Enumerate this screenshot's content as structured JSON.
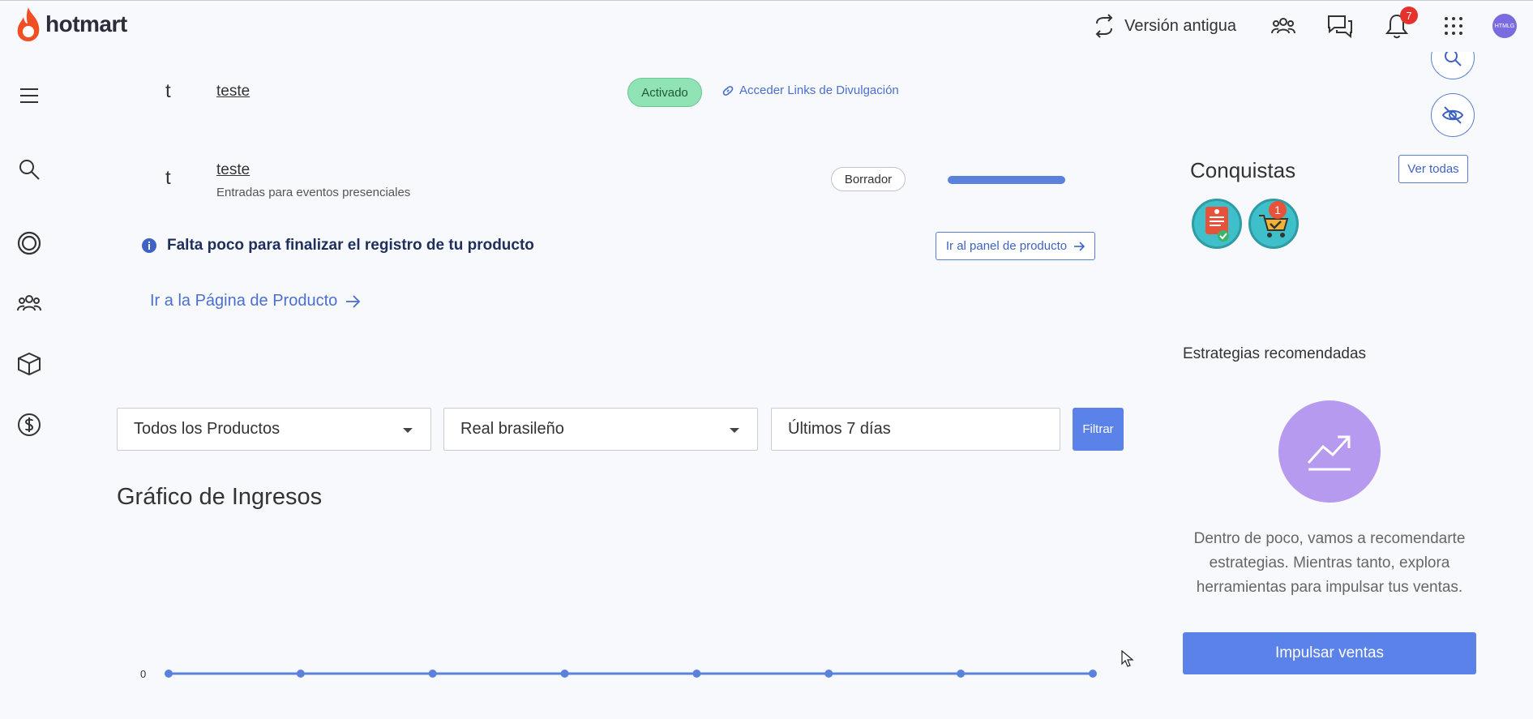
{
  "header": {
    "logo_text": "hotmart",
    "old_version_label": "Versión antigua",
    "notifications_count": "7",
    "avatar_text": "HTMLG"
  },
  "sidebar": {
    "items": [
      "menu-icon",
      "search-icon",
      "target-icon",
      "users-icon",
      "box-icon",
      "dollar-icon"
    ]
  },
  "products": [
    {
      "initial": "t",
      "name": "teste",
      "status": "Activado",
      "link_label": "Acceder Links de Divulgación"
    },
    {
      "initial": "t",
      "name": "teste",
      "subtitle": "Entradas para eventos presenciales",
      "status": "Borrador",
      "progress": 1.0
    }
  ],
  "notice": {
    "text": "Falta poco para finalizar el registro de tu producto",
    "button_label": "Ir al panel de producto"
  },
  "product_page_link": "Ir a la Página de Producto",
  "filters": {
    "products": "Todos los Productos",
    "currency": "Real brasileño",
    "period": "Últimos 7 días",
    "button": "Filtrar"
  },
  "chart_title": "Gráfico de Ingresos",
  "chart_data": {
    "type": "line",
    "x": [
      1,
      2,
      3,
      4,
      5,
      6,
      7,
      8
    ],
    "values": [
      0,
      0,
      0,
      0,
      0,
      0,
      0,
      0
    ],
    "y_tick_label": "0",
    "color": "#5a82dc"
  },
  "achievements": {
    "title": "Conquistas",
    "view_all": "Ver todas",
    "badge_count_label": "1"
  },
  "strategies": {
    "title": "Estrategias recomendadas",
    "text": "Dentro de poco, vamos a recomendarte estrategias. Mientras tanto, explora herramientas para impulsar tus ventas.",
    "button": "Impulsar ventas"
  },
  "colors": {
    "accent": "#5a82e8",
    "active_pill": "#8fe3b4",
    "notification": "#e5322d",
    "strategy_circle": "#b59af0"
  }
}
